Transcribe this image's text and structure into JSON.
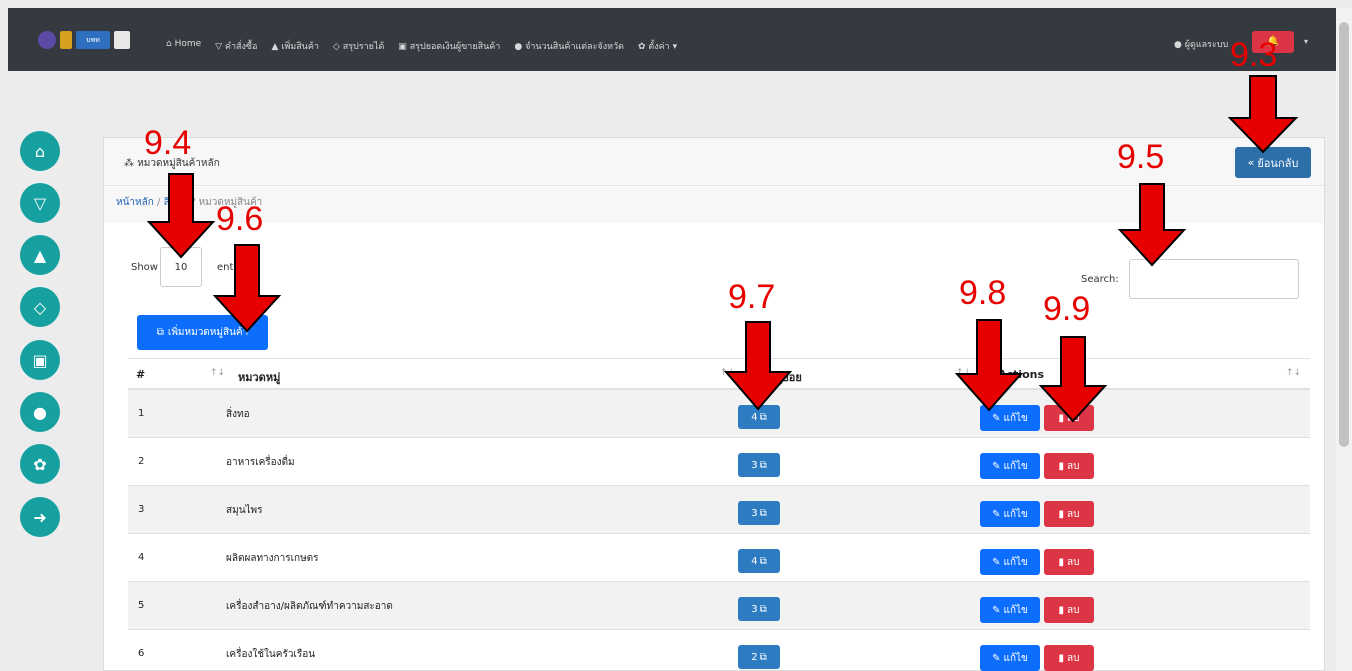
{
  "topbar": {
    "nav": [
      {
        "icon": "home-icon",
        "glyph": "⌂",
        "label": "Home"
      },
      {
        "icon": "cart-icon",
        "glyph": "▽",
        "label": "คำสั่งซื้อ"
      },
      {
        "icon": "bag-icon",
        "glyph": "▲",
        "label": "เพิ่มสินค้า"
      },
      {
        "icon": "gem-icon",
        "glyph": "◇",
        "label": "สรุปรายได้"
      },
      {
        "icon": "money-icon",
        "glyph": "▣",
        "label": "สรุปยอดเงินผู้ขายสินค้า"
      },
      {
        "icon": "pin-icon",
        "glyph": "●",
        "label": "จำนวนสินค้าแต่ละจังหวัด"
      },
      {
        "icon": "gear-icon",
        "glyph": "✿",
        "label": "ตั้งค่า ▾"
      }
    ],
    "user": "ผู้ดูแลระบบ",
    "logo_text": "บพท",
    "bell_glyph": "🔔"
  },
  "sidebar": [
    {
      "icon": "home-icon",
      "glyph": "⌂"
    },
    {
      "icon": "cart-icon",
      "glyph": "▽"
    },
    {
      "icon": "bag-icon",
      "glyph": "▲"
    },
    {
      "icon": "gem-icon",
      "glyph": "◇"
    },
    {
      "icon": "money-icon",
      "glyph": "▣"
    },
    {
      "icon": "pin-icon",
      "glyph": "●"
    },
    {
      "icon": "gear-icon",
      "glyph": "✿"
    },
    {
      "icon": "logout-icon",
      "glyph": "➜"
    }
  ],
  "card": {
    "title": "หมวดหมู่สินค้าหลัก",
    "back_label": "ย้อนกลับ",
    "breadcrumb": [
      "หน้าหลัก",
      "สินค้า",
      "หมวดหมู่สินค้า"
    ],
    "show_label": "Show",
    "entries_value": "10",
    "entries_label": "entries",
    "search_label": "Search:",
    "add_label": "เพิ่มหมวดหมู่สินค้า"
  },
  "table": {
    "headers": [
      "#",
      "หมวดหมู่",
      "หมวดหมู่ย่อย",
      "Actions"
    ],
    "edit_label": "แก้ไข",
    "delete_label": "ลบ",
    "rows": [
      {
        "num": "1",
        "name": "สิ่งทอ",
        "count": "4"
      },
      {
        "num": "2",
        "name": "อาหารเครื่องดื่ม",
        "count": "3"
      },
      {
        "num": "3",
        "name": "สมุนไพร",
        "count": "3"
      },
      {
        "num": "4",
        "name": "ผลิตผลทางการเกษตร",
        "count": "4"
      },
      {
        "num": "5",
        "name": "เครื่องสำอาง/ผลิตภัณฑ์ทำความสะอาด",
        "count": "3"
      },
      {
        "num": "6",
        "name": "เครื่องใช้ในครัวเรือน",
        "count": "2"
      }
    ]
  },
  "annotations": [
    "9.3",
    "9.4",
    "9.5",
    "9.6",
    "9.7",
    "9.8",
    "9.9"
  ]
}
